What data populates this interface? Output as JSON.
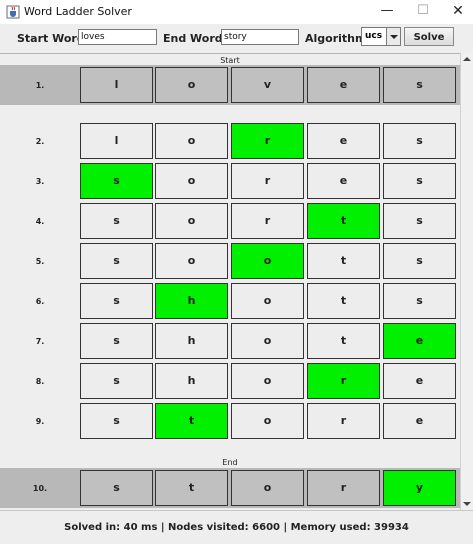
{
  "window": {
    "title": "Word Ladder Solver",
    "minimize": "—",
    "maximize": "☐",
    "close": "✕"
  },
  "toolbar": {
    "start_label": "Start Word:",
    "start_value": "loves",
    "end_label": "End Word:",
    "end_value": "story",
    "algorithm_label": "Algorithm:",
    "algorithm_value": "ucs",
    "solve_label": "Solve"
  },
  "ladder": {
    "start_label": "Start",
    "end_label": "End",
    "rows": [
      {
        "num": "1.",
        "letters": [
          "l",
          "o",
          "v",
          "e",
          "s"
        ],
        "changed": -1,
        "kind": "start"
      },
      {
        "num": "2.",
        "letters": [
          "l",
          "o",
          "r",
          "e",
          "s"
        ],
        "changed": 2,
        "kind": "step"
      },
      {
        "num": "3.",
        "letters": [
          "s",
          "o",
          "r",
          "e",
          "s"
        ],
        "changed": 0,
        "kind": "step"
      },
      {
        "num": "4.",
        "letters": [
          "s",
          "o",
          "r",
          "t",
          "s"
        ],
        "changed": 3,
        "kind": "step"
      },
      {
        "num": "5.",
        "letters": [
          "s",
          "o",
          "o",
          "t",
          "s"
        ],
        "changed": 2,
        "kind": "step"
      },
      {
        "num": "6.",
        "letters": [
          "s",
          "h",
          "o",
          "t",
          "s"
        ],
        "changed": 1,
        "kind": "step"
      },
      {
        "num": "7.",
        "letters": [
          "s",
          "h",
          "o",
          "t",
          "e"
        ],
        "changed": 4,
        "kind": "step"
      },
      {
        "num": "8.",
        "letters": [
          "s",
          "h",
          "o",
          "r",
          "e"
        ],
        "changed": 3,
        "kind": "step"
      },
      {
        "num": "9.",
        "letters": [
          "s",
          "t",
          "o",
          "r",
          "e"
        ],
        "changed": 1,
        "kind": "step"
      },
      {
        "num": "10.",
        "letters": [
          "s",
          "t",
          "o",
          "r",
          "y"
        ],
        "changed": 4,
        "kind": "end"
      }
    ]
  },
  "status": {
    "text": "Solved in: 40 ms   |   Nodes visited: 6600   |   Memory used: 39934"
  },
  "colors": {
    "highlight": "#00f000",
    "shaded_row": "#b8b8b8"
  },
  "icons": {
    "app": "java-cup-icon"
  }
}
